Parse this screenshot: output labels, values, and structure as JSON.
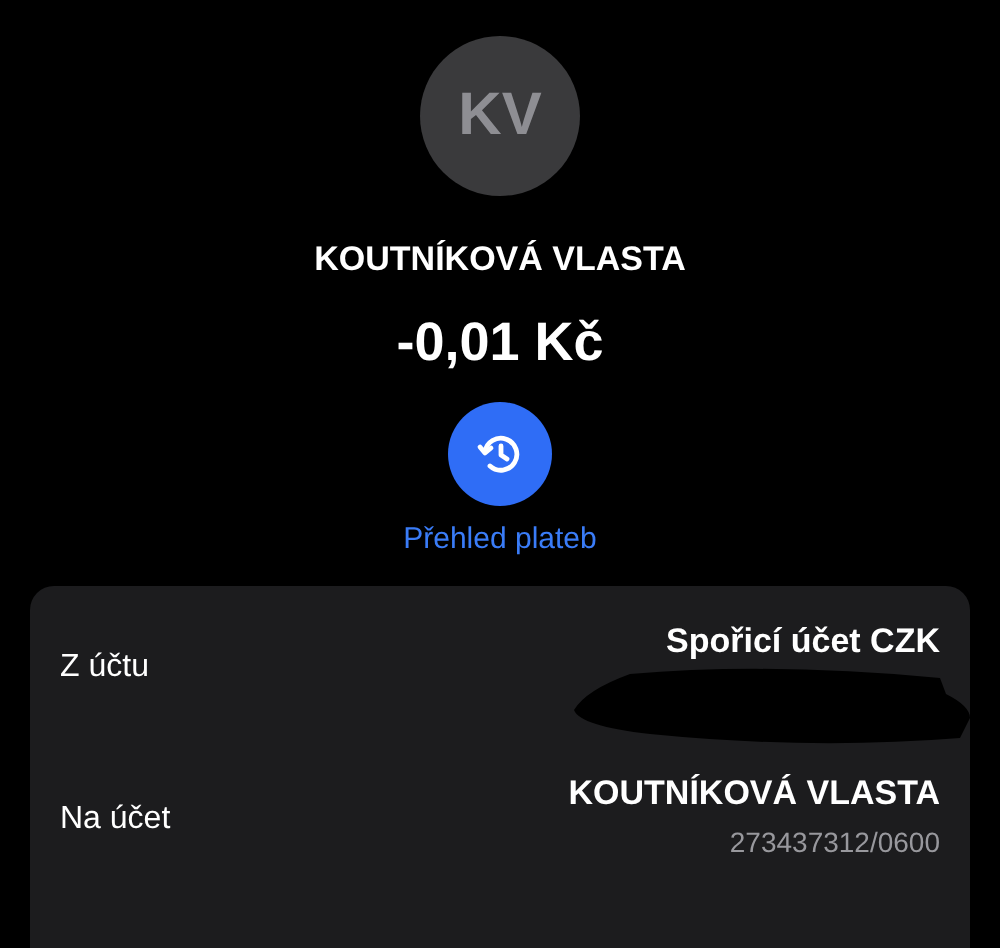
{
  "avatar": {
    "initials": "KV"
  },
  "counterparty": "KOUTNÍKOVÁ VLASTA",
  "amount": "-0,01 Kč",
  "history_link": {
    "label": "Přehled plateb"
  },
  "details": [
    {
      "label": "Z účtu",
      "value": "Spořicí účet CZK",
      "redacted": true
    },
    {
      "label": "Na účet",
      "value": "KOUTNÍKOVÁ VLASTA",
      "account": "273437312/0600",
      "redacted": false
    }
  ]
}
